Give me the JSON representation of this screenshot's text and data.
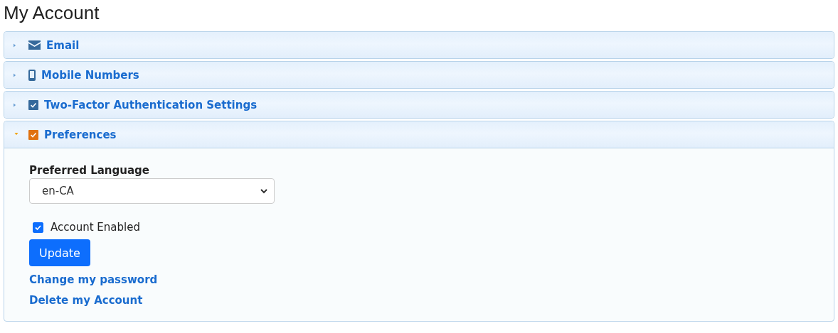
{
  "page_title": "My Account",
  "sections": [
    {
      "title": "Email",
      "kind": "envelope",
      "expanded": false
    },
    {
      "title": "Mobile Numbers",
      "kind": "phone",
      "expanded": false
    },
    {
      "title": "Two-Factor Authentication Settings",
      "kind": "check",
      "expanded": false
    },
    {
      "title": "Preferences",
      "kind": "check",
      "expanded": true
    }
  ],
  "preferences": {
    "language_label": "Preferred Language",
    "language_value": "en-CA",
    "account_enabled": {
      "label": "Account Enabled",
      "checked": true
    },
    "update_button": "Update",
    "links": [
      "Change my password",
      "Delete my Account"
    ]
  }
}
